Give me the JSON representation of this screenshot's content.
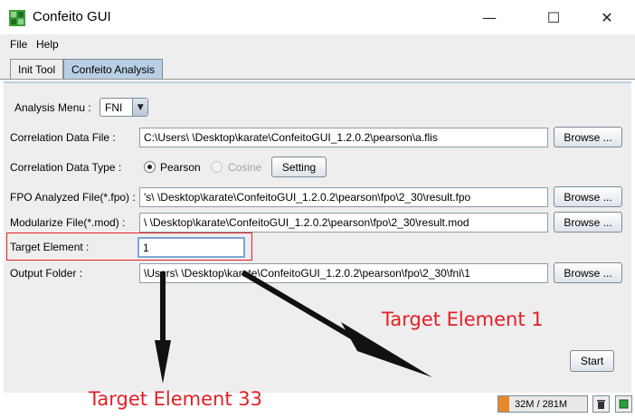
{
  "window": {
    "title": "Confeito GUI",
    "minimize_glyph": "—",
    "maximize_glyph": "☐",
    "close_glyph": "✕"
  },
  "menu": [
    "File",
    "Help"
  ],
  "tabs": [
    {
      "label": "Init Tool",
      "active": false
    },
    {
      "label": "Confeito Analysis",
      "active": true
    }
  ],
  "analysis": {
    "menu_label": "Analysis Menu :",
    "menu_value": "FNI",
    "correlation_file_label": "Correlation Data File :",
    "correlation_file_value": "C:\\Users\\                          \\Desktop\\karate\\ConfeitoGUI_1.2.0.2\\pearson\\a.flis",
    "correlation_type_label": "Correlation Data Type :",
    "radio_pearson": "Pearson",
    "radio_cosine": "Cosine",
    "setting_button": "Setting",
    "fpo_label": "FPO Analyzed File(*.fpo) :",
    "fpo_value": "'s\\                          \\Desktop\\karate\\ConfeitoGUI_1.2.0.2\\pearson\\fpo\\2_30\\result.fpo",
    "mod_label": "Modularize File(*.mod) :",
    "mod_value": "\\                          \\Desktop\\karate\\ConfeitoGUI_1.2.0.2\\pearson\\fpo\\2_30\\result.mod",
    "target_label": "Target Element :",
    "target_value": "1",
    "output_label": "Output Folder :",
    "output_value": "\\Users\\                          \\Desktop\\karate\\ConfeitoGUI_1.2.0.2\\pearson\\fpo\\2_30\\fni\\1",
    "browse_label": "Browse ...",
    "start_label": "Start"
  },
  "annotations": {
    "right": "Target Element 1",
    "bottom": "Target Element 33",
    "color": "#e31e24"
  },
  "status": {
    "memory": "32M / 281M"
  },
  "colors": {
    "panel": "#eeeeee",
    "active_tab": "#b8cfe5",
    "highlight": "#e31e24"
  }
}
